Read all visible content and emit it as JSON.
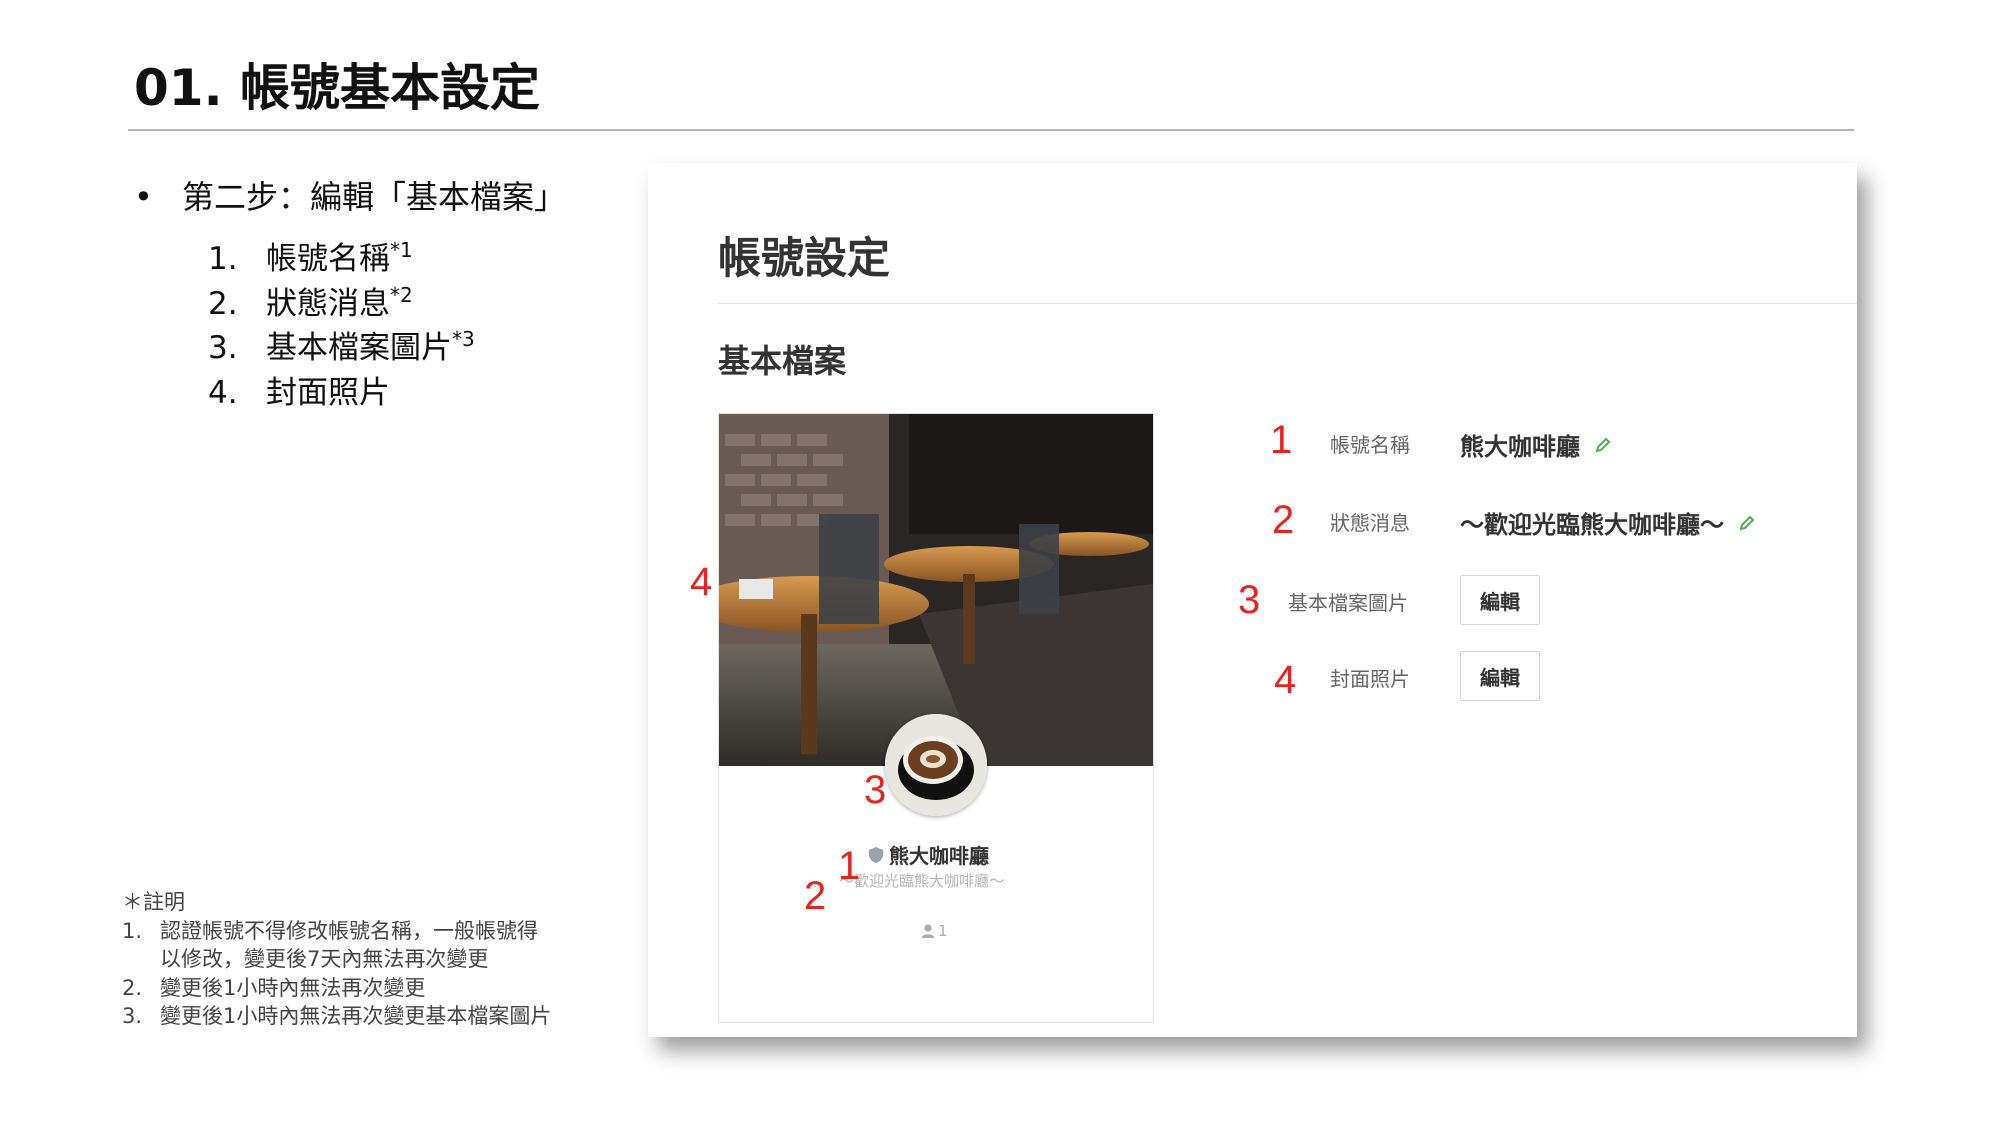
{
  "slide": {
    "title": "01. 帳號基本設定",
    "step": "第二步：編輯「基本檔案」",
    "bullet": "•",
    "substeps": [
      {
        "num": "1.",
        "label": "帳號名稱",
        "note": "*1"
      },
      {
        "num": "2.",
        "label": "狀態消息",
        "note": "*2"
      },
      {
        "num": "3.",
        "label": "基本檔案圖片",
        "note": "*3"
      },
      {
        "num": "4.",
        "label": "封面照片",
        "note": ""
      }
    ],
    "notes": {
      "heading": "＊註明",
      "items": [
        {
          "num": "1.",
          "lines": [
            "認證帳號不得修改帳號名稱，一般帳號得",
            "以修改，變更後7天內無法再次變更"
          ]
        },
        {
          "num": "2.",
          "lines": [
            "變更後1小時內無法再次變更"
          ]
        },
        {
          "num": "3.",
          "lines": [
            "變更後1小時內無法再次變更基本檔案圖片"
          ]
        }
      ]
    }
  },
  "settings": {
    "title": "帳號設定",
    "section": "基本檔案",
    "preview": {
      "name": "熊大咖啡廳",
      "status": "～歡迎光臨熊大咖啡廳～",
      "friends": "1"
    },
    "rows": [
      {
        "label": "帳號名稱",
        "value": "熊大咖啡廳"
      },
      {
        "label": "狀態消息",
        "value": "～歡迎光臨熊大咖啡廳～"
      },
      {
        "label": "基本檔案圖片",
        "button": "編輯"
      },
      {
        "label": "封面照片",
        "button": "編輯"
      }
    ]
  },
  "markers": {
    "m1": "1",
    "m2": "2",
    "m3": "3",
    "m4": "4"
  },
  "colors": {
    "marker": "#e8231f",
    "edit_pencil": "#4caf50",
    "accent_text": "#333333"
  },
  "icons": {
    "edit": "pencil-icon",
    "verified": "shield-icon",
    "friends": "person-icon"
  }
}
